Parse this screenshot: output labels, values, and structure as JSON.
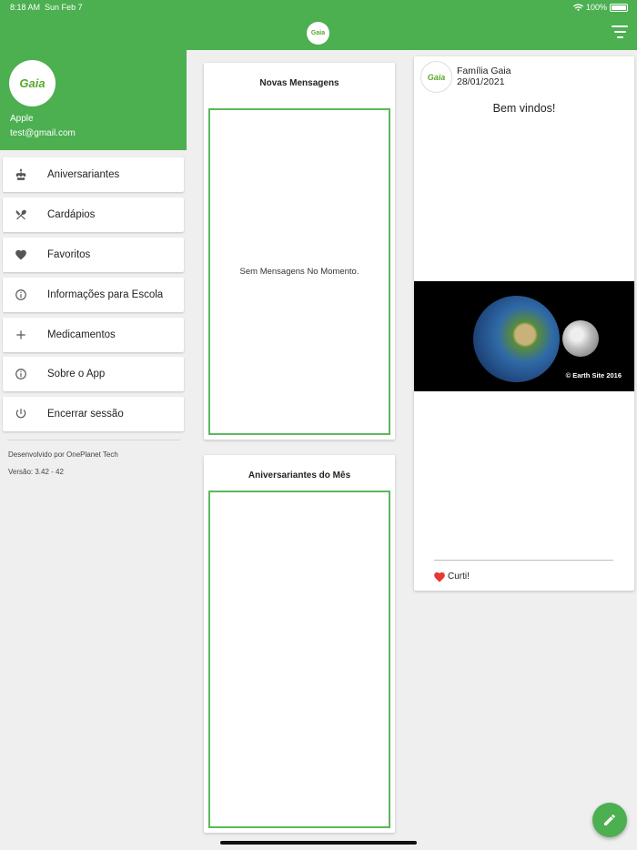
{
  "status_bar": {
    "time": "8:18 AM",
    "date": "Sun Feb 7",
    "battery": "100%"
  },
  "app": {
    "logo_text": "Gaia"
  },
  "drawer": {
    "user_name": "Apple",
    "user_email": "test@gmail.com",
    "items": [
      {
        "label": "Aniversariantes",
        "icon": "cake-icon"
      },
      {
        "label": "Cardápios",
        "icon": "utensils-icon"
      },
      {
        "label": "Favoritos",
        "icon": "heart-icon"
      },
      {
        "label": "Informações para Escola",
        "icon": "info-icon"
      },
      {
        "label": "Medicamentos",
        "icon": "plus-icon"
      },
      {
        "label": "Sobre o App",
        "icon": "info-icon"
      },
      {
        "label": "Encerrar sessão",
        "icon": "power-icon"
      }
    ],
    "developer": "Desenvolvido por OnePlanet Tech",
    "version": "Versão: 3.42 - 42"
  },
  "messages_card": {
    "title": "Novas Mensagens",
    "empty_text": "Sem Mensagens No Momento."
  },
  "birthdays_card": {
    "title": "Aniversariantes do Mês"
  },
  "post": {
    "author": "Família Gaia",
    "date": "28/01/2021",
    "text": "Bem vindos!",
    "image_caption": "© Earth Site 2016",
    "like_label": "Curti!"
  },
  "colors": {
    "primary": "#4caf50",
    "border_green": "#5cb85c",
    "like_red": "#e53935"
  }
}
